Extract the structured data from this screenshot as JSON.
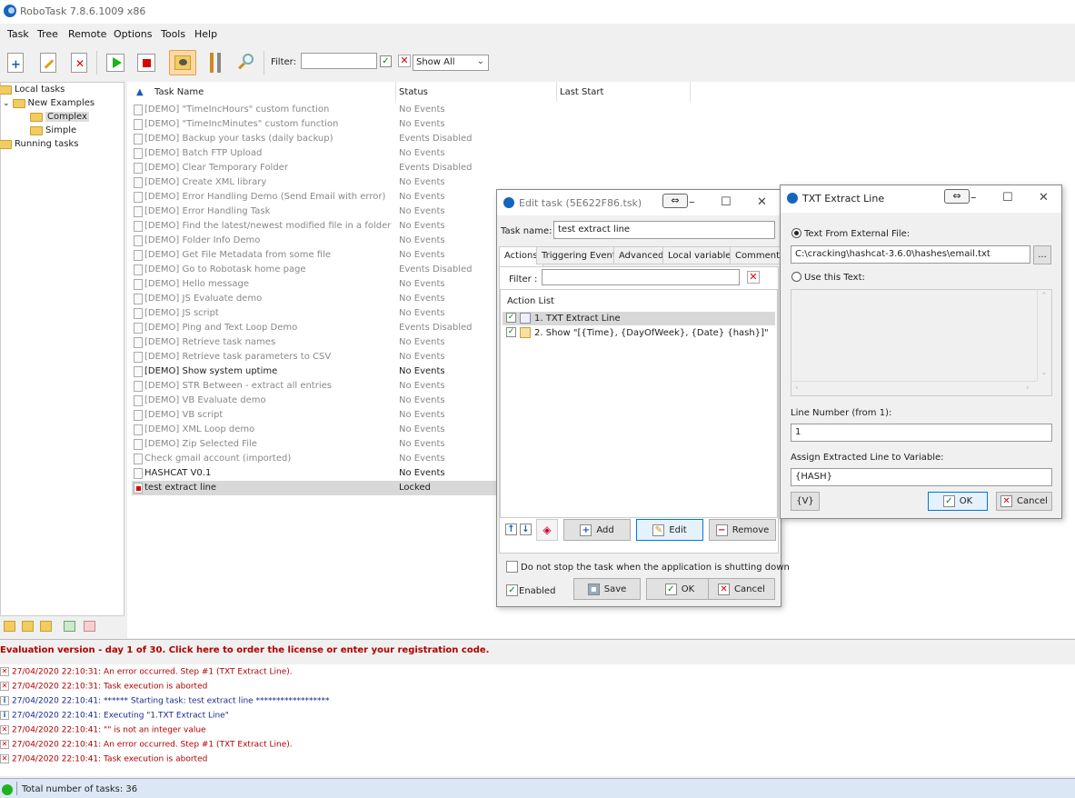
{
  "app": {
    "title": "RoboTask 7.8.6.1009 x86"
  },
  "menu": [
    "Task",
    "Tree",
    "Remote",
    "Options",
    "Tools",
    "Help"
  ],
  "toolbar": {
    "filter_label": "Filter:",
    "filter_value": "",
    "filter_checked": true,
    "show_mode": "Show All"
  },
  "tree": [
    {
      "label": "Local tasks",
      "level": 0
    },
    {
      "label": "New Examples",
      "level": 1
    },
    {
      "label": "Complex",
      "level": 2,
      "selected": true
    },
    {
      "label": "Simple",
      "level": 2
    },
    {
      "label": "Running tasks",
      "level": 0
    }
  ],
  "tasklist": {
    "columns": {
      "name": "Task Name",
      "status": "Status",
      "last_start": "Last Start"
    },
    "rows": [
      {
        "name": "[DEMO] \"TimeIncHours\" custom function",
        "status": "No Events"
      },
      {
        "name": "[DEMO] \"TimeIncMinutes\" custom function",
        "status": "No Events"
      },
      {
        "name": "[DEMO] Backup your tasks (daily backup)",
        "status": "Events Disabled"
      },
      {
        "name": "[DEMO] Batch FTP Upload",
        "status": "No Events"
      },
      {
        "name": "[DEMO] Clear Temporary Folder",
        "status": "Events Disabled"
      },
      {
        "name": "[DEMO] Create XML library",
        "status": "No Events"
      },
      {
        "name": "[DEMO] Error Handling Demo (Send Email with error)",
        "status": "No Events"
      },
      {
        "name": "[DEMO] Error Handling Task",
        "status": "No Events"
      },
      {
        "name": "[DEMO] Find the latest/newest modified file in a folder",
        "status": "No Events"
      },
      {
        "name": "[DEMO] Folder Info Demo",
        "status": "No Events"
      },
      {
        "name": "[DEMO] Get File Metadata from some file",
        "status": "No Events"
      },
      {
        "name": "[DEMO] Go to Robotask home page",
        "status": "Events Disabled"
      },
      {
        "name": "[DEMO] Hello message",
        "status": "No Events"
      },
      {
        "name": "[DEMO] JS Evaluate demo",
        "status": "No Events"
      },
      {
        "name": "[DEMO] JS script",
        "status": "No Events"
      },
      {
        "name": "[DEMO] Ping and Text Loop Demo",
        "status": "Events Disabled"
      },
      {
        "name": "[DEMO] Retrieve task names",
        "status": "No Events"
      },
      {
        "name": "[DEMO] Retrieve task parameters to CSV",
        "status": "No Events"
      },
      {
        "name": "[DEMO] Show system uptime",
        "status": "No Events",
        "dark": true
      },
      {
        "name": "[DEMO] STR Between - extract all entries",
        "status": "No Events"
      },
      {
        "name": "[DEMO] VB Evaluate demo",
        "status": "No Events"
      },
      {
        "name": "[DEMO] VB script",
        "status": "No Events"
      },
      {
        "name": "[DEMO] XML Loop demo",
        "status": "No Events"
      },
      {
        "name": "[DEMO] Zip Selected File",
        "status": "No Events"
      },
      {
        "name": "Check gmail account (imported)",
        "status": "No Events"
      },
      {
        "name": "HASHCAT V0.1",
        "status": "No Events",
        "dark": true
      },
      {
        "name": "test extract line",
        "status": "Locked",
        "selected": true
      }
    ]
  },
  "eval_notice": "Evaluation version - day 1 of 30. Click here to order the license or enter your registration code.",
  "log": [
    {
      "type": "error",
      "text": "27/04/2020 22:10:31: An error occurred. Step #1 (TXT Extract Line)."
    },
    {
      "type": "error",
      "text": "27/04/2020 22:10:31: Task execution is aborted"
    },
    {
      "type": "info",
      "text": "27/04/2020 22:10:41: ****** Starting task: test extract line ******************"
    },
    {
      "type": "info",
      "text": "27/04/2020 22:10:41: Executing \"1.TXT Extract Line\""
    },
    {
      "type": "error",
      "text": "27/04/2020 22:10:41: \"\" is not an integer value"
    },
    {
      "type": "error",
      "text": "27/04/2020 22:10:41: An error occurred. Step #1 (TXT Extract Line)."
    },
    {
      "type": "error",
      "text": "27/04/2020 22:10:41: Task execution is aborted"
    }
  ],
  "status_bar": {
    "text": "Total number of tasks: 36"
  },
  "edit_task": {
    "title": "Edit task (5E622F86.tsk)",
    "task_name_label": "Task name:",
    "task_name_value": "test extract line",
    "tabs": [
      "Actions",
      "Triggering Events",
      "Advanced",
      "Local variables",
      "Comments"
    ],
    "filter_label": "Filter :",
    "filter_value": "",
    "action_list_label": "Action List",
    "actions": [
      {
        "label": "1. TXT Extract Line",
        "checked": true,
        "selected": true
      },
      {
        "label": "2. Show \"[{Time}, {DayOfWeek}, {Date} {hash}]\"",
        "checked": true
      }
    ],
    "add_label": "Add",
    "edit_label": "Edit",
    "remove_label": "Remove",
    "no_stop_label": "Do not stop the task when the application is shutting down",
    "no_stop_checked": false,
    "enabled_label": "Enabled",
    "enabled_checked": true,
    "save_label": "Save",
    "ok_label": "OK",
    "cancel_label": "Cancel"
  },
  "txt_extract": {
    "title": "TXT Extract Line",
    "opt_file_label": "Text From External File:",
    "opt_file_selected": true,
    "file_path": "C:\\cracking\\hashcat-3.6.0\\hashes\\email.txt",
    "browse_label": "...",
    "opt_text_label": "Use this Text:",
    "text_value": "",
    "line_number_label": "Line Number (from 1):",
    "line_number_value": "1",
    "assign_label": "Assign Extracted Line to Variable:",
    "assign_value": "{HASH}",
    "var_button_label": "{V}",
    "ok_label": "OK",
    "cancel_label": "Cancel"
  },
  "colors": {
    "error": "#b00000",
    "info": "#1a2a8a",
    "selection": "#d8d8d8",
    "status_ok": "#1db31d",
    "accent": "#0078d7"
  }
}
